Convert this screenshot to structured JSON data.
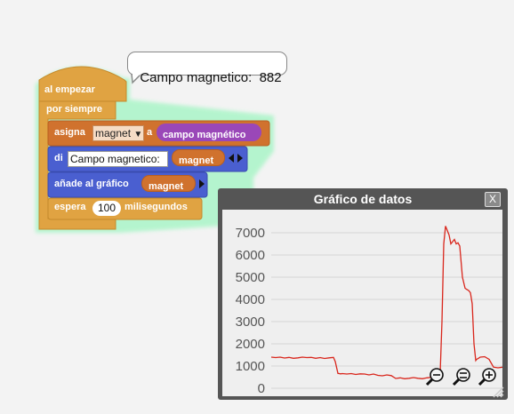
{
  "speech_bubble": {
    "text": "Campo magnetico:  882"
  },
  "script": {
    "hat_label": "al empezar",
    "forever_label": "por siempre",
    "set_block": {
      "label": "asigna",
      "variable": "magnet",
      "to_label": "a",
      "value": "campo magnético"
    },
    "say_block": {
      "label": "di",
      "text": "Campo magnetico:",
      "variable": "magnet"
    },
    "add_graph_block": {
      "label": "añade al gráfico",
      "variable": "magnet"
    },
    "wait_block": {
      "label": "espera",
      "value": "100",
      "unit": "milisegundos"
    }
  },
  "graph_window": {
    "title": "Gráfico de datos",
    "close_label": "X",
    "line_color": "#d9261c",
    "zoom_icons": [
      "zoom-out-icon",
      "zoom-reset-icon",
      "zoom-in-icon"
    ]
  },
  "chart_data": {
    "type": "line",
    "ylim": [
      0,
      7000
    ],
    "y_ticks": [
      "7000",
      "6000",
      "5000",
      "4000",
      "3000",
      "2000",
      "1000",
      "0"
    ],
    "grid": true,
    "x": [
      0,
      5,
      10,
      15,
      20,
      25,
      30,
      35,
      40,
      45,
      50,
      55,
      60,
      65,
      70,
      72,
      75,
      78,
      80,
      85,
      90,
      95,
      100,
      105,
      110,
      115,
      120,
      125,
      130,
      135,
      140,
      145,
      150,
      155,
      160,
      165,
      170,
      175,
      180,
      183,
      186,
      188,
      190,
      192,
      194,
      196,
      198,
      200,
      202,
      204,
      206,
      208,
      210,
      212,
      215,
      218,
      220,
      222,
      224,
      226,
      228,
      230,
      231,
      233,
      235,
      240,
      245,
      250,
      255,
      260
    ],
    "y": [
      1400,
      1380,
      1400,
      1360,
      1390,
      1350,
      1370,
      1400,
      1380,
      1390,
      1350,
      1380,
      1340,
      1370,
      1390,
      1200,
      670,
      650,
      660,
      640,
      660,
      620,
      650,
      640,
      600,
      640,
      580,
      560,
      600,
      570,
      440,
      470,
      430,
      450,
      480,
      450,
      430,
      470,
      490,
      550,
      600,
      650,
      700,
      3000,
      6500,
      7300,
      7100,
      6900,
      6500,
      6600,
      6700,
      6500,
      6550,
      6400,
      5000,
      4500,
      4450,
      4400,
      4300,
      3800,
      2000,
      1250,
      1300,
      1350,
      1400,
      1420,
      1300,
      950,
      920,
      950
    ]
  }
}
